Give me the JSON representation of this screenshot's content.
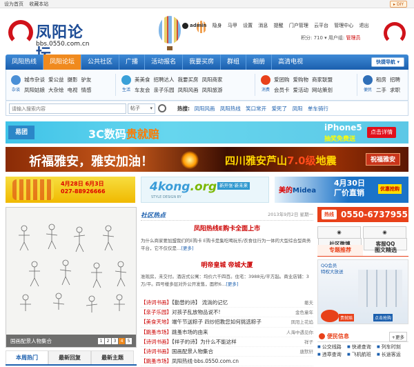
{
  "topbar": {
    "links": [
      "设为首页",
      "收藏本站"
    ],
    "diy": "DIY"
  },
  "logo": {
    "name": "凤阳论坛",
    "url": "bbs.0550.com.cn"
  },
  "user": {
    "name": "admin",
    "status": "隐身",
    "links": [
      "马甲",
      "设置",
      "消息",
      "提醒",
      "门户管理",
      "云平台",
      "管理中心",
      "退出"
    ],
    "points_label": "积分: 710",
    "group_label": "用户组:",
    "group": "管理员"
  },
  "nav": {
    "items": [
      "凤阳热线",
      "凤阳论坛",
      "公共社区",
      "广播",
      "活动报名",
      "我要买房",
      "群组",
      "相册",
      "高清电视"
    ],
    "active": "凤阳论坛",
    "quick": "快捷导航"
  },
  "subnav": {
    "groups": [
      {
        "icon": "杂谈",
        "links": [
          "城市杂谈",
          "爱公益",
          "摄影",
          "驴友",
          "凤阳姑娘",
          "大杂烩",
          "电视",
          "情感"
        ]
      },
      {
        "icon": "生活",
        "links": [
          "美美食",
          "招聘达人",
          "我要买房",
          "凤阳商家",
          "车友会",
          "亲子乐园",
          "凤阳风画",
          "凤阳旅游"
        ]
      },
      {
        "icon": "消费",
        "links": [
          "爱团购",
          "爱购物",
          "商家联盟",
          "会员卡",
          "爱活动",
          "网站策划"
        ]
      },
      {
        "icon": "便民",
        "links": [
          "租房",
          "招聘",
          "二手",
          "求职"
        ]
      }
    ]
  },
  "search": {
    "placeholder": "请输入搜索内容",
    "scope": "帖子",
    "hot_label": "热搜:",
    "hot": [
      "凤阳风画",
      "凤阳热线",
      "笑口常开",
      "爱死了",
      "凤阳",
      "单车骑行"
    ]
  },
  "banners": {
    "b1_logo": "易团",
    "b1_main": "3C数码",
    "b1_main2": "贵就赔",
    "b1_phone": "iPhone5",
    "b1_phone_sub": "抽奖免费送",
    "b1_btn": "点击详情",
    "b2_left": "祈福雅安，雅安加油！",
    "b2_mid": "四川雅安芦山",
    "b2_mid2": "7.0级",
    "b2_mid3": "地震",
    "b2_btn": "祝福雅安",
    "ad_a_text": "4月28日 6月3日",
    "ad_a_phone": "027-88926666",
    "ad_b_brand": "4kong",
    "ad_b_brand2": ".org",
    "ad_b_sub": "STYLE DESIGN BY",
    "ad_b_tag": "新开张·新未来",
    "ad_c_brand": "美的",
    "ad_c_brand2": "Midea",
    "ad_c_date": "4月30日",
    "ad_c_date2": "厂价直销",
    "ad_c_btn": "优惠抢购"
  },
  "slideshow": {
    "caption": "国画配景人物集合",
    "pages": [
      "1",
      "2",
      "3",
      "4",
      "5"
    ],
    "active_page": "4"
  },
  "left_tabs": [
    "本周热门",
    "最新回复",
    "最新主题"
  ],
  "community": {
    "label": "社区热点",
    "date": "2013年9月2日 星期一",
    "headline1": "凤阳热线E购卡全面上市",
    "para1": "为什么商家要加盟我们的E购卡 E购卡是集吃喝玩乐/衣食住行为一体的大型综合型商务平台，它不仅仅是…",
    "more1": "[更多]",
    "headline2": "明帝皇城 帝城大厦",
    "para2": "准现房，未交付。酒店式公寓：均价六千四百。住宅：3988元/平方起。商业店铺：3万/平。四号楼多层对外公开发售，面积6…",
    "more2": "[更多]",
    "news": [
      {
        "tag": "【诗词书画】",
        "title": "【勤曾的诗】 流淌的记忆",
        "author": "撤夫"
      },
      {
        "tag": "【亲子乐园】",
        "title": "对孩子乱放物品说不!",
        "author": "金色童年"
      },
      {
        "tag": "【美食天地】",
        "title": "端午节送粽子 四炒招教您如何挑选粽子",
        "author": "凤阳上花焰"
      },
      {
        "tag": "【跳蚤市场】",
        "title": "跳蚤市场的由来",
        "author": "人海中遇见你"
      },
      {
        "tag": "【诗词书画】",
        "title": "【祥子的诗】为什么不能这样",
        "author": "祥子"
      },
      {
        "tag": "【诗词书画】",
        "title": "国画配景人物集合",
        "author": "唐默轩"
      },
      {
        "tag": "【跳蚤市场】",
        "title": "凤阳热线·bbs.0550.com.cn",
        "author": ""
      }
    ]
  },
  "right": {
    "phone_icon": "热线",
    "phone": "0550-6737955",
    "buttons": [
      "社区微博",
      "客服QQ"
    ],
    "tabs": [
      "专题推荐",
      "图文精选"
    ],
    "ad_text1": "QQ会员",
    "ad_text2": "特权大放送",
    "ad_badge": "贵就赔",
    "ad_btn": "点击抢购",
    "conv_title": "便民信息",
    "conv_more": "+更多",
    "conv_links": [
      "公交线路",
      "快递查询",
      "列车时刻",
      "违章查询",
      "飞机航班",
      "长途客运"
    ]
  }
}
